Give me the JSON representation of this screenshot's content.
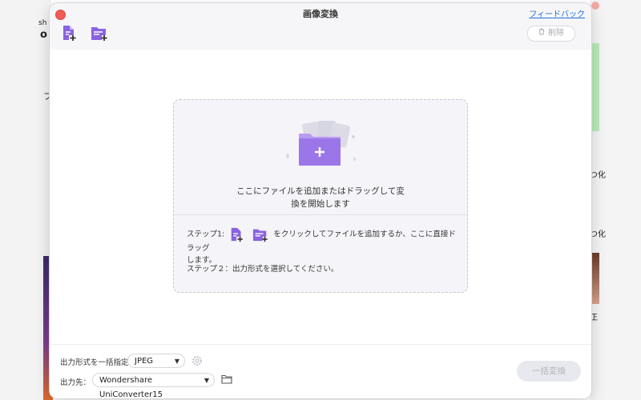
{
  "dialog": {
    "title": "画像変換",
    "feedback_link": "フィードバック",
    "delete_label": "削除"
  },
  "dropzone": {
    "main_text_line1": "ここにファイルを追加またはドラッグして変",
    "main_text_line2": "換を開始します",
    "step1_prefix": "ステップ1:",
    "step1_suffix": "をクリックしてファイルを追加するか、ここに直接ドラッグ",
    "step1_line2": "します。",
    "step2": "ステップ２：出力形式を選択してください。"
  },
  "footer": {
    "format_label": "出力形式を一括指定",
    "format_value": "JPEG",
    "output_label": "出力先：",
    "output_value": "Wondershare UniConverter15",
    "convert_all_label": "一括変換"
  },
  "icons": {
    "add_file": "add-file-icon",
    "add_folder": "add-folder-icon",
    "trash": "trash-icon",
    "gear": "gear-icon",
    "folder": "folder-icon"
  },
  "colors": {
    "accent_purple": "#8a63e0",
    "close_red": "#ee5b55",
    "link_blue": "#1f6fd6",
    "disabled_button": "#e8e9ef"
  }
}
